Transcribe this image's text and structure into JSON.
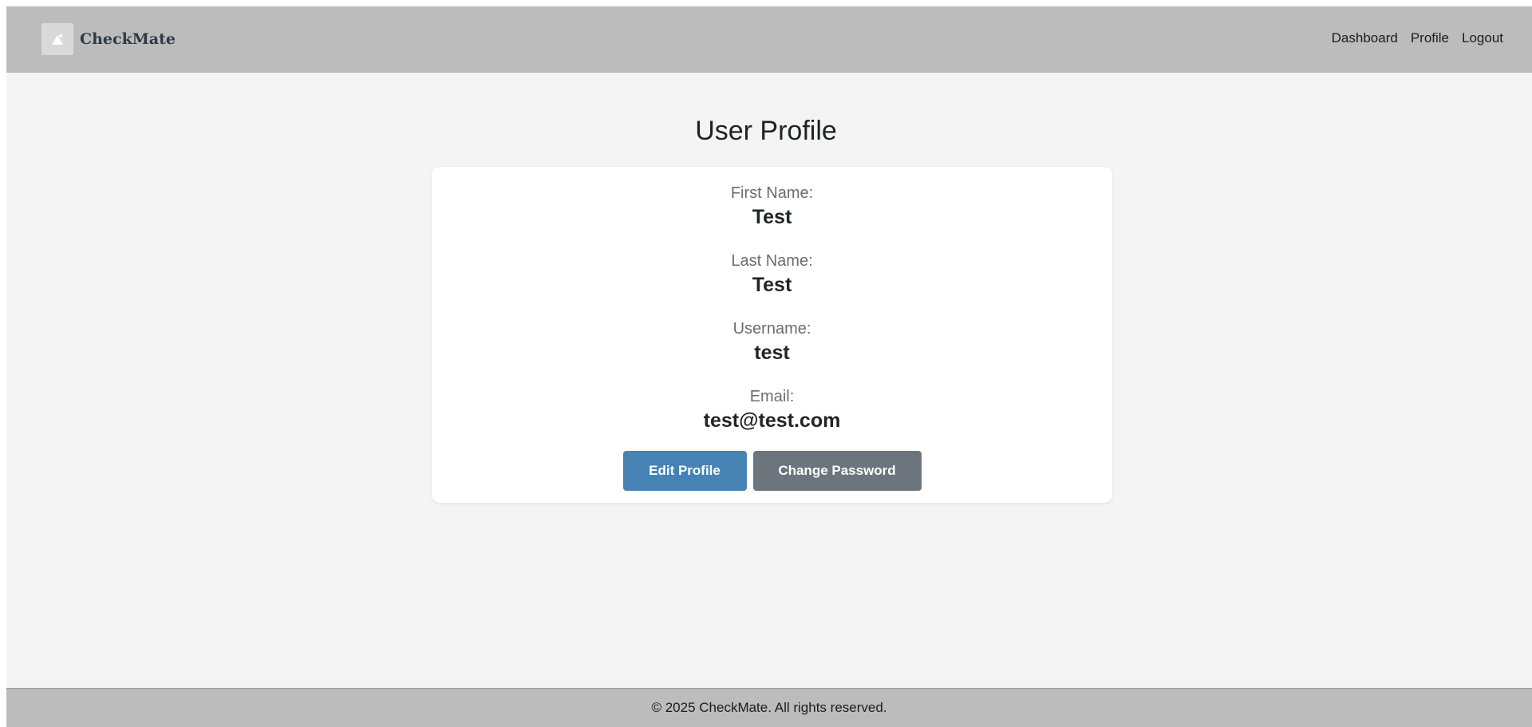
{
  "navbar": {
    "brand_name": "CheckMate",
    "links": {
      "dashboard": "Dashboard",
      "profile": "Profile",
      "logout": "Logout"
    }
  },
  "main": {
    "title": "User Profile",
    "fields": {
      "first_name": {
        "label": "First Name:",
        "value": "Test"
      },
      "last_name": {
        "label": "Last Name:",
        "value": "Test"
      },
      "username": {
        "label": "Username:",
        "value": "test"
      },
      "email": {
        "label": "Email:",
        "value": "test@test.com"
      }
    },
    "buttons": {
      "edit_profile": "Edit Profile",
      "change_password": "Change Password"
    }
  },
  "footer": {
    "text": "© 2025 CheckMate. All rights reserved."
  },
  "colors": {
    "primary_button": "#4682b4",
    "secondary_button": "#6c757d",
    "navbar_bg": "#bcbcbc",
    "page_bg": "#f4f4f4"
  }
}
